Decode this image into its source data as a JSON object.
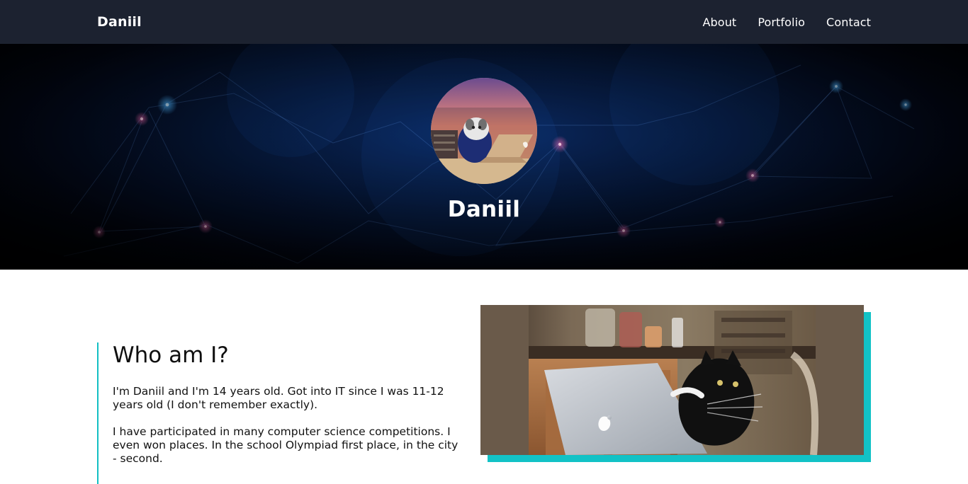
{
  "nav": {
    "brand": "Daniil",
    "links": [
      "About",
      "Portfolio",
      "Contact"
    ]
  },
  "hero": {
    "title": "Daniil"
  },
  "about": {
    "title": "Who am I?",
    "paragraphs": [
      "I'm Daniil and I'm 14 years old. Got into IT since I was 11-12 years old (I don't remember exactly).",
      "I have participated in many computer science competitions. I even won places. In the school Olympiad first place, in the city - second."
    ]
  },
  "colors": {
    "navbar": "#1c2230",
    "accent": "#12bfc3"
  },
  "icons": {
    "avatar": "cat-laptop-avatar",
    "media": "cat-laptop-photo"
  }
}
